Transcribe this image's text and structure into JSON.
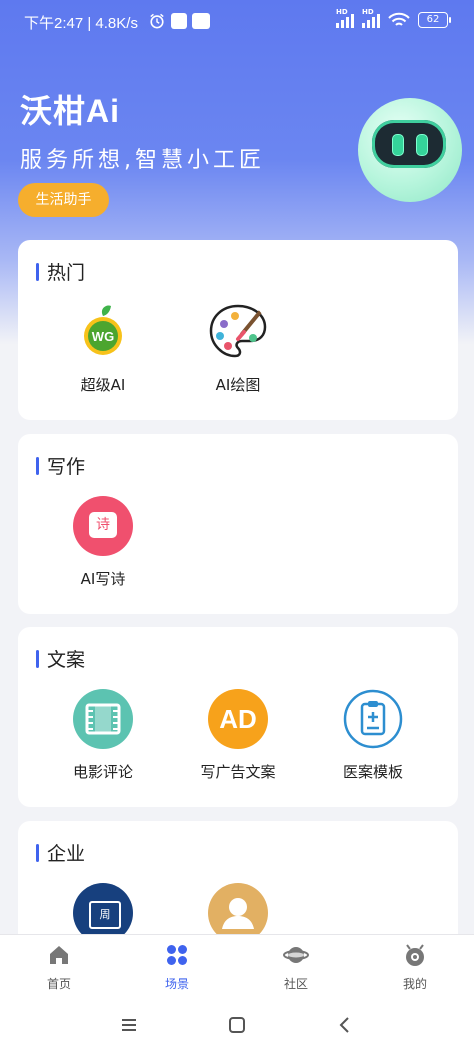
{
  "status": {
    "time": "下午2:47 | 4.8K/s",
    "battery": "62",
    "hd": "HD"
  },
  "header": {
    "title": "沃柑Ai",
    "slogan": "服务所想,智慧小工匠",
    "chip": "生活助手"
  },
  "sections": [
    {
      "title": "热门",
      "items": [
        {
          "label": "超级AI",
          "icon": "wg-orange-icon"
        },
        {
          "label": "AI绘图",
          "icon": "palette-icon"
        }
      ]
    },
    {
      "title": "写作",
      "items": [
        {
          "label": "AI写诗",
          "icon": "poem-icon",
          "glyph": "诗"
        }
      ]
    },
    {
      "title": "文案",
      "items": [
        {
          "label": "电影评论",
          "icon": "film-icon"
        },
        {
          "label": "写广告文案",
          "icon": "ad-icon",
          "glyph": "AD"
        },
        {
          "label": "医案模板",
          "icon": "medical-clipboard-icon"
        }
      ]
    },
    {
      "title": "企业",
      "items": [
        {
          "label": "",
          "icon": "calendar-week-icon",
          "glyph": "周"
        },
        {
          "label": "",
          "icon": "person-icon"
        }
      ]
    }
  ],
  "tabs": [
    {
      "label": "首页",
      "icon": "home-icon",
      "active": false
    },
    {
      "label": "场景",
      "icon": "grid-icon",
      "active": true
    },
    {
      "label": "社区",
      "icon": "planet-icon",
      "active": false
    },
    {
      "label": "我的",
      "icon": "profile-icon",
      "active": false
    }
  ],
  "colors": {
    "accent": "#3f63ee",
    "chip": "#f6ae2d",
    "film": "#5cc3b1",
    "ad": "#f7a21b",
    "poem": "#f0506e",
    "calendar": "#17407e",
    "person": "#e2b063"
  }
}
